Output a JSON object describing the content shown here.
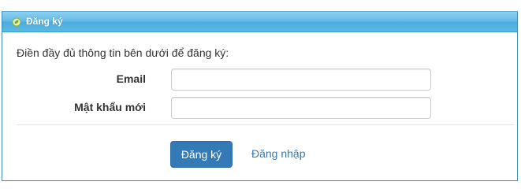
{
  "header": {
    "title": "Đăng ký",
    "icon": "leaf-icon"
  },
  "form": {
    "intro": "Điền đầy đủ thông tin bên dưới để đăng ký:",
    "email_label": "Email",
    "email_value": "",
    "password_label": "Mật khẩu mới",
    "password_value": ""
  },
  "actions": {
    "register_label": "Đăng ký",
    "login_link": "Đăng nhập"
  },
  "colors": {
    "header": "#5db8e3",
    "primary": "#337ab7",
    "link": "#337ab7"
  }
}
